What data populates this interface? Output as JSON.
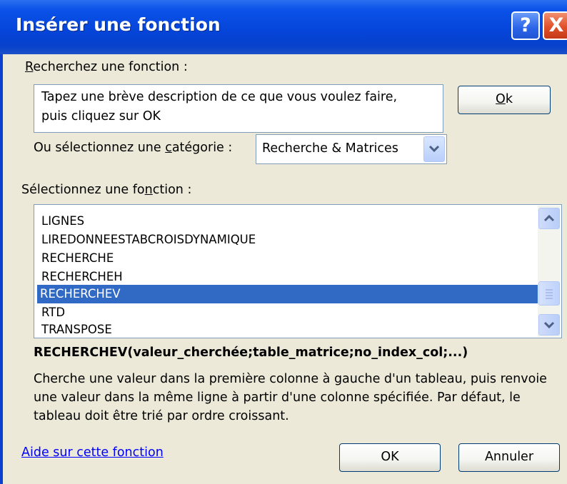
{
  "window": {
    "title": "Insérer une fonction",
    "help_glyph": "?",
    "close_glyph": "X"
  },
  "search": {
    "label_first": "R",
    "label_rest": "echerchez une fonction :",
    "box_text_line1": "Tapez une brève description de ce que vous voulez faire,",
    "box_text_line2": "puis cliquez sur OK",
    "ok_first": "O",
    "ok_rest": "k"
  },
  "category": {
    "label_before": "Ou sélectionnez une ",
    "label_accel": "c",
    "label_after": "atégorie :",
    "selected": "Recherche & Matrices"
  },
  "functions": {
    "label_before": "Sélectionnez une fo",
    "label_accel": "n",
    "label_after": "ction :",
    "items": [
      "LIGNES",
      "LIREDONNEESTABCROISDYNAMIQUE",
      "RECHERCHE",
      "RECHERCHEH",
      "RECHERCHEV",
      "RTD",
      "TRANSPOSE"
    ],
    "selected_index": 4
  },
  "details": {
    "signature": "RECHERCHEV(valeur_cherchée;table_matrice;no_index_col;...)",
    "description": "Cherche une valeur dans la première colonne à gauche d'un tableau, puis renvoie une valeur dans la même ligne à partir d'une colonne spécifiée. Par défaut, le tableau doit être trié par ordre croissant."
  },
  "footer": {
    "help_link": "Aide sur cette fonction",
    "ok_label": "OK",
    "cancel_label": "Annuler"
  },
  "icons": {
    "scroll_up": "chevron-up-icon",
    "scroll_down": "chevron-down-icon",
    "dropdown": "chevron-down-icon",
    "thumb_grip": "grip-icon"
  },
  "colors": {
    "titlebar": "#0545da",
    "selection": "#316ac5",
    "dialog_face": "#ece9d8",
    "link": "#0000ff",
    "close_button": "#e0502a"
  }
}
